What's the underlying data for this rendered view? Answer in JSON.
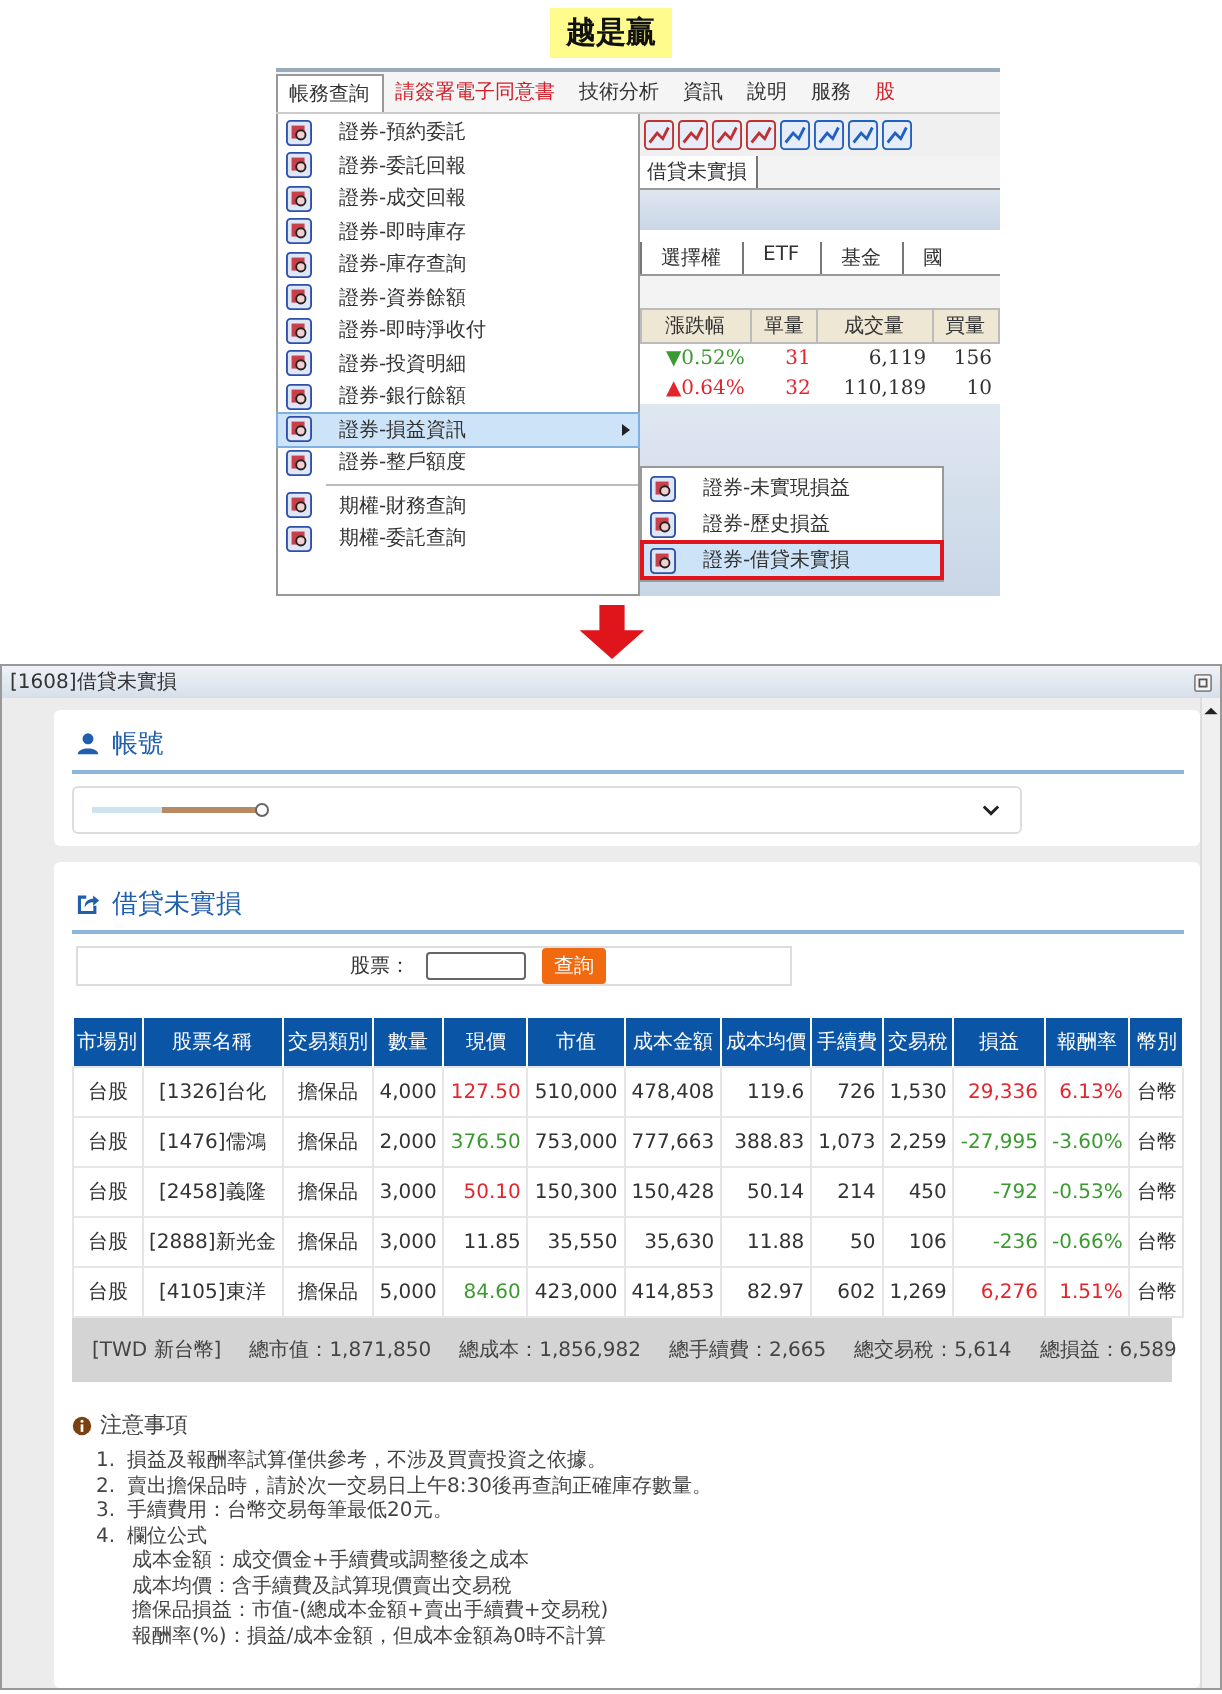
{
  "caption": "越是贏",
  "menu_screenshot": {
    "menubar": [
      {
        "label": "帳務查詢",
        "selected": true,
        "kind": "normal"
      },
      {
        "label": "請簽署電子同意書",
        "selected": false,
        "kind": "alert"
      },
      {
        "label": "技術分析",
        "selected": false,
        "kind": "normal"
      },
      {
        "label": "資訊",
        "selected": false,
        "kind": "normal"
      },
      {
        "label": "說明",
        "selected": false,
        "kind": "normal"
      },
      {
        "label": "服務",
        "selected": false,
        "kind": "normal"
      },
      {
        "label": "股",
        "selected": false,
        "kind": "alert"
      }
    ],
    "dropdown_groups": [
      [
        {
          "label": "證券-預約委託",
          "selected": false,
          "has_submenu": false
        },
        {
          "label": "證券-委託回報",
          "selected": false,
          "has_submenu": false
        },
        {
          "label": "證券-成交回報",
          "selected": false,
          "has_submenu": false
        },
        {
          "label": "證券-即時庫存",
          "selected": false,
          "has_submenu": false
        },
        {
          "label": "證券-庫存查詢",
          "selected": false,
          "has_submenu": false
        },
        {
          "label": "證券-資券餘額",
          "selected": false,
          "has_submenu": false
        },
        {
          "label": "證券-即時淨收付",
          "selected": false,
          "has_submenu": false
        },
        {
          "label": "證券-投資明細",
          "selected": false,
          "has_submenu": false
        },
        {
          "label": "證券-銀行餘額",
          "selected": false,
          "has_submenu": false
        },
        {
          "label": "證券-損益資訊",
          "selected": true,
          "has_submenu": true
        },
        {
          "label": "證券-整戶額度",
          "selected": false,
          "has_submenu": false
        }
      ],
      [
        {
          "label": "期權-財務查詢",
          "selected": false,
          "has_submenu": false
        },
        {
          "label": "期權-委託查詢",
          "selected": false,
          "has_submenu": false
        }
      ]
    ],
    "submenu": [
      {
        "label": "證券-未實現損益",
        "selected": false,
        "outlined": false
      },
      {
        "label": "證券-歷史損益",
        "selected": false,
        "outlined": false
      },
      {
        "label": "證券-借貸未實損",
        "selected": true,
        "outlined": true
      }
    ],
    "background_tab": "借貸未實損",
    "background_tabs": [
      "選擇權",
      "ETF",
      "基金",
      "國"
    ],
    "quote_table": {
      "columns": [
        "漲跌幅",
        "單量",
        "成交量",
        "買量"
      ],
      "rows": [
        {
          "change": {
            "text": "▼0.52%",
            "color": "#3a9a2f"
          },
          "size": "31",
          "volume": "6,119",
          "bid_size": "156"
        },
        {
          "change": {
            "text": "▲0.64%",
            "color": "#e3262d"
          },
          "size": "32",
          "volume": "110,189",
          "bid_size": "10"
        }
      ]
    }
  },
  "window": {
    "title": "[1608]借貸未實損",
    "account_section": {
      "heading": "帳號"
    },
    "unrealized_section": {
      "heading": "借貸未實損",
      "search": {
        "label": "股票：",
        "button": "查詢"
      }
    },
    "table": {
      "columns": [
        "市場別",
        "股票名稱",
        "交易類別",
        "數量",
        "現價",
        "市值",
        "成本金額",
        "成本均價",
        "手續費",
        "交易稅",
        "損益",
        "報酬率",
        "幣別"
      ],
      "rows": [
        {
          "cells": [
            {
              "text": "台股"
            },
            {
              "text": "[1326]台化"
            },
            {
              "text": "擔保品"
            },
            {
              "text": "4,000"
            },
            {
              "text": "127.50",
              "color": "#e3262d"
            },
            {
              "text": "510,000"
            },
            {
              "text": "478,408"
            },
            {
              "text": "119.6"
            },
            {
              "text": "726"
            },
            {
              "text": "1,530"
            },
            {
              "text": "29,336",
              "color": "#e3262d"
            },
            {
              "text": "6.13%",
              "color": "#e3262d"
            },
            {
              "text": "台幣"
            }
          ]
        },
        {
          "cells": [
            {
              "text": "台股"
            },
            {
              "text": "[1476]儒鴻"
            },
            {
              "text": "擔保品"
            },
            {
              "text": "2,000"
            },
            {
              "text": "376.50",
              "color": "#3a9a2f"
            },
            {
              "text": "753,000"
            },
            {
              "text": "777,663"
            },
            {
              "text": "388.83"
            },
            {
              "text": "1,073"
            },
            {
              "text": "2,259"
            },
            {
              "text": "-27,995",
              "color": "#3a9a2f"
            },
            {
              "text": "-3.60%",
              "color": "#3a9a2f"
            },
            {
              "text": "台幣"
            }
          ]
        },
        {
          "cells": [
            {
              "text": "台股"
            },
            {
              "text": "[2458]義隆"
            },
            {
              "text": "擔保品"
            },
            {
              "text": "3,000"
            },
            {
              "text": "50.10",
              "color": "#e3262d"
            },
            {
              "text": "150,300"
            },
            {
              "text": "150,428"
            },
            {
              "text": "50.14"
            },
            {
              "text": "214"
            },
            {
              "text": "450"
            },
            {
              "text": "-792",
              "color": "#3a9a2f"
            },
            {
              "text": "-0.53%",
              "color": "#3a9a2f"
            },
            {
              "text": "台幣"
            }
          ]
        },
        {
          "cells": [
            {
              "text": "台股"
            },
            {
              "text": "[2888]新光金"
            },
            {
              "text": "擔保品"
            },
            {
              "text": "3,000"
            },
            {
              "text": "11.85"
            },
            {
              "text": "35,550"
            },
            {
              "text": "35,630"
            },
            {
              "text": "11.88"
            },
            {
              "text": "50"
            },
            {
              "text": "106"
            },
            {
              "text": "-236",
              "color": "#3a9a2f"
            },
            {
              "text": "-0.66%",
              "color": "#3a9a2f"
            },
            {
              "text": "台幣"
            }
          ]
        },
        {
          "cells": [
            {
              "text": "台股"
            },
            {
              "text": "[4105]東洋"
            },
            {
              "text": "擔保品"
            },
            {
              "text": "5,000"
            },
            {
              "text": "84.60",
              "color": "#3a9a2f"
            },
            {
              "text": "423,000"
            },
            {
              "text": "414,853"
            },
            {
              "text": "82.97"
            },
            {
              "text": "602"
            },
            {
              "text": "1,269"
            },
            {
              "text": "6,276",
              "color": "#e3262d"
            },
            {
              "text": "1.51%",
              "color": "#e3262d"
            },
            {
              "text": "台幣"
            }
          ]
        }
      ],
      "summary": {
        "currency": "[TWD 新台幣]",
        "items": [
          "總市值：1,871,850",
          "總成本：1,856,982",
          "總手續費：2,665",
          "總交易稅：5,614",
          "總損益：6,589"
        ]
      }
    },
    "notes": {
      "heading": "注意事項",
      "items": [
        {
          "number": "1.",
          "text": "損益及報酬率試算僅供參考，不涉及買賣投資之依據。"
        },
        {
          "number": "2.",
          "text": "賣出擔保品時，請於次一交易日上午8:30後再查詢正確庫存數量。"
        },
        {
          "number": "3.",
          "text": "手續費用：台幣交易每筆最低20元。"
        },
        {
          "number": "4.",
          "text": "欄位公式",
          "lines": [
            "成本金額：成交價金+手續費或調整後之成本",
            "成本均價：含手續費及試算現價賣出交易稅",
            "擔保品損益：市值-(總成本金額+賣出手續費+交易稅)",
            "報酬率(%)：損益/成本金額，但成本金額為0時不計算"
          ]
        }
      ]
    }
  }
}
